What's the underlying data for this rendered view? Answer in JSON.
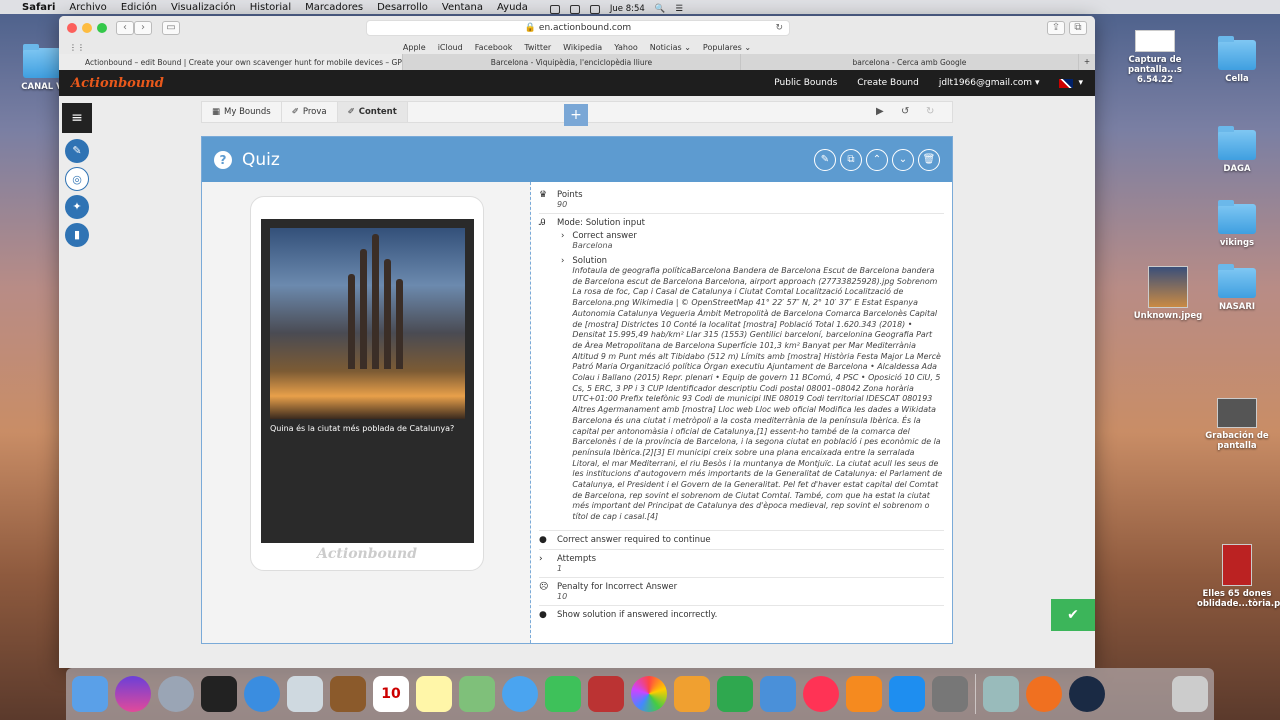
{
  "menubar": {
    "items": [
      "Safari",
      "Archivo",
      "Edición",
      "Visualización",
      "Historial",
      "Marcadores",
      "Desarrollo",
      "Ventana",
      "Ayuda"
    ],
    "clock": "Jue 8:54"
  },
  "desktop": {
    "left_label": "CANAL V",
    "icons": [
      {
        "label": "Captura de pantalla...s 6.54.22",
        "icon": "screenshot-thumb"
      },
      {
        "label": "Cella",
        "icon": "folder-icon"
      },
      {
        "label": "DAGA",
        "icon": "folder-icon"
      },
      {
        "label": "vikings",
        "icon": "folder-icon"
      },
      {
        "label": "Unknown.jpeg",
        "icon": "image-thumb"
      },
      {
        "label": "NASARI",
        "icon": "folder-icon"
      },
      {
        "label": "Grabación de pantalla",
        "icon": "video-thumb"
      },
      {
        "label": "Elles 65 dones oblidade...tòria.pdf",
        "icon": "pdf-thumb"
      }
    ]
  },
  "browser": {
    "url": "en.actionbound.com",
    "favorites": [
      "Apple",
      "iCloud",
      "Facebook",
      "Twitter",
      "Wikipedia",
      "Yahoo",
      "Noticias ⌄",
      "Populares ⌄"
    ],
    "tabs": [
      "Actionbound – edit Bound | Create your own scavenger hunt for mobile devices – GPS...",
      "Barcelona - Viquipèdia, l'enciclopèdia lliure",
      "barcelona - Cerca amb Google"
    ]
  },
  "app": {
    "logo": "Actionbound",
    "nav": [
      "Public Bounds",
      "Create Bound"
    ],
    "user": "jdlt1966@gmail.com"
  },
  "breadcrumbs": [
    "My Bounds",
    "Prova",
    "Content"
  ],
  "quiz": {
    "title": "Quiz",
    "question": "Quina és la ciutat més poblada de Catalunya?",
    "watermark": "Actionbound",
    "points_label": "Points",
    "points_value": "90",
    "mode": "Mode: Solution input",
    "correct_answer_label": "Correct answer",
    "correct_answer_value": "Barcelona",
    "solution_label": "Solution",
    "solution_text": "Infotaula de geografia políticaBarcelona Bandera de Barcelona Escut de Barcelona bandera de Barcelona escut de Barcelona Barcelona, airport approach (27733825928).jpg Sobrenom La rosa de foc, Cap i Casal de Catalunya i Ciutat Comtal Localització Localització de Barcelona.png Wikimedia | © OpenStreetMap 41° 22′ 57″ N, 2° 10′ 37″ E Estat Espanya Autonomia Catalunya Vegueria Àmbit Metropolità de Barcelona Comarca Barcelonès Capital de [mostra] Districtes 10 Conté la localitat [mostra] Població Total 1.620.343 (2018) • Densitat 15.995,49 hab/km² Llar 315 (1553) Gentilici barceloní, barcelonina Geografia Part de Àrea Metropolitana de Barcelona Superfície 101,3 km² Banyat per Mar Mediterrània Altitud 9 m Punt més alt Tibidabo (512 m) Límits amb [mostra] Història Festa Major La Mercè Patró Maria Organització política Òrgan executiu Ajuntament de Barcelona • Alcaldessa Ada Colau i Ballano (2015) Repr. plenari • Equip de govern 11 BComú, 4 PSC • Oposició 10 CiU, 5 Cs, 5 ERC, 3 PP i 3 CUP Identificador descriptiu Codi postal 08001–08042 Zona horària UTC+01:00 Prefix telefònic 93 Codi de municipi INE 08019 Codi territorial IDESCAT 080193 Altres Agermanament amb [mostra] Lloc web Lloc web oficial Modifica les dades a Wikidata Barcelona és una ciutat i metròpoli a la costa mediterrània de la península Ibèrica. És la capital per antonomàsia i oficial de Catalunya,[1] essent-ho també de la comarca del Barcelonès i de la província de Barcelona, i la segona ciutat en població i pes econòmic de la península Ibèrica.[2][3] El municipi creix sobre una plana encaixada entre la serralada Litoral, el mar Mediterrani, el riu Besòs i la muntanya de Montjuïc. La ciutat acull les seus de les institucions d'autogovern més importants de la Generalitat de Catalunya: el Parlament de Catalunya, el President i el Govern de la Generalitat. Pel fet d'haver estat capital del Comtat de Barcelona, rep sovint el sobrenom de Ciutat Comtal. També, com que ha estat la ciutat més important del Principat de Catalunya des d'època medieval, rep sovint el sobrenom o títol de cap i casal.[4]",
    "correct_required": "Correct answer required to continue",
    "attempts_label": "Attempts",
    "attempts_value": "1",
    "penalty_label": "Penalty for Incorrect Answer",
    "penalty_value": "10",
    "show_solution": "Show solution if answered incorrectly."
  },
  "dock": {
    "calendar_month": "ENE",
    "calendar_day": "10"
  }
}
